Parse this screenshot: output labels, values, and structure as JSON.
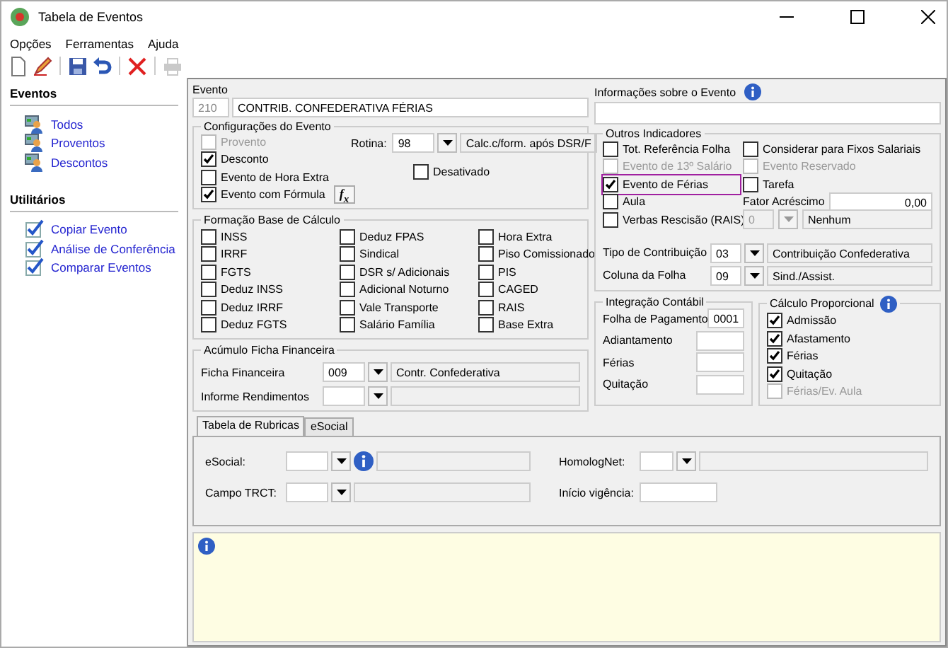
{
  "window": {
    "title": "Tabela de Eventos"
  },
  "menu": [
    {
      "label": "Opções"
    },
    {
      "label": "Ferramentas"
    },
    {
      "label": "Ajuda"
    }
  ],
  "toolbar": [
    {
      "kind": "new",
      "disabled": false
    },
    {
      "kind": "edit",
      "disabled": false
    },
    {
      "kind": "save",
      "disabled": false
    },
    {
      "kind": "undo",
      "disabled": false
    },
    {
      "kind": "delete",
      "disabled": false
    },
    {
      "kind": "print",
      "disabled": true
    }
  ],
  "sidebar": [
    {
      "title": "Eventos",
      "items": [
        {
          "label": "Todos",
          "kind": "group"
        },
        {
          "label": "Proventos",
          "kind": "group"
        },
        {
          "label": "Descontos",
          "kind": "group"
        }
      ]
    },
    {
      "title": "Utilitários",
      "items": [
        {
          "label": "Copiar Evento",
          "kind": "check"
        },
        {
          "label": "Análise de Conferência",
          "kind": "check"
        },
        {
          "label": "Comparar Eventos",
          "kind": "check"
        }
      ]
    }
  ],
  "evento": {
    "label": "Evento",
    "code": "210",
    "name": "CONTRIB. CONFEDERATIVA FÉRIAS"
  },
  "info": {
    "label": "Informações sobre o Evento"
  },
  "config": {
    "title": "Configurações do Evento",
    "checks": [
      {
        "label": "Provento",
        "checked": false,
        "disabled": true
      },
      {
        "label": "Desconto",
        "checked": true,
        "disabled": false
      },
      {
        "label": "Evento de Hora Extra",
        "checked": false,
        "disabled": false
      },
      {
        "label": "Evento com Fórmula",
        "checked": true,
        "disabled": false
      }
    ],
    "formula_button": "f$_{x}$",
    "rotina": {
      "label": "Rotina:",
      "code": "98",
      "desc": "Calc.c/form. após DSR/F"
    },
    "desativado": {
      "label": "Desativado",
      "checked": false
    }
  },
  "base": {
    "title": "Formação Base de Cálculo",
    "columns": [
      [
        {
          "label": "INSS",
          "checked": false
        },
        {
          "label": "IRRF",
          "checked": false
        },
        {
          "label": "FGTS",
          "checked": false
        },
        {
          "label": "Deduz INSS",
          "checked": false
        },
        {
          "label": "Deduz IRRF",
          "checked": false
        },
        {
          "label": "Deduz FGTS",
          "checked": false
        }
      ],
      [
        {
          "label": "Deduz FPAS",
          "checked": false
        },
        {
          "label": "Sindical",
          "checked": false
        },
        {
          "label": "DSR s/ Adicionais",
          "checked": false
        },
        {
          "label": "Adicional Noturno",
          "checked": false
        },
        {
          "label": "Vale Transporte",
          "checked": false
        },
        {
          "label": "Salário Família",
          "checked": false
        }
      ],
      [
        {
          "label": "Hora Extra",
          "checked": false
        },
        {
          "label": "Piso Comissionado",
          "checked": false
        },
        {
          "label": "PIS",
          "checked": false
        },
        {
          "label": "CAGED",
          "checked": false
        },
        {
          "label": "RAIS",
          "checked": false
        },
        {
          "label": "Base Extra",
          "checked": false
        }
      ]
    ]
  },
  "acumulo": {
    "title": "Acúmulo Ficha Financeira",
    "rows": [
      {
        "label": "Ficha Financeira",
        "code": "009",
        "desc": "Contr. Confederativa"
      },
      {
        "label": "Informe Rendimentos"
      }
    ]
  },
  "outros": {
    "title": "Outros Indicadores",
    "left": [
      {
        "label": "Tot. Referência Folha",
        "checked": false,
        "disabled": false,
        "focused": false
      },
      {
        "label": "Evento de 13º Salário",
        "checked": false,
        "disabled": true,
        "focused": false
      },
      {
        "label": "Evento de Férias",
        "checked": true,
        "disabled": false,
        "focused": true
      },
      {
        "label": "Aula",
        "checked": false,
        "disabled": false,
        "focused": false
      },
      {
        "label": "Verbas Rescisão (RAIS)",
        "checked": false,
        "disabled": false,
        "focused": false
      }
    ],
    "right": [
      {
        "label": "Considerar para Fixos Salariais",
        "checked": false,
        "disabled": false,
        "focused": false
      },
      {
        "label": "Evento Reservado",
        "checked": false,
        "disabled": true,
        "focused": false
      },
      {
        "label": "Tarefa",
        "checked": false,
        "disabled": false,
        "focused": false
      }
    ],
    "fator": {
      "label": "Fator Acréscimo",
      "value": "0,00"
    },
    "aula_combo": {
      "code": "0",
      "desc": "Nenhum",
      "disabled": true
    },
    "combos": [
      {
        "label": "Tipo de Contribuição",
        "code": "03",
        "desc": "Contribuição Confederativa"
      },
      {
        "label": "Coluna da Folha",
        "code": "09",
        "desc": "Sind./Assist."
      }
    ]
  },
  "integracao": {
    "title": "Integração Contábil",
    "rows": [
      {
        "label": "Folha de Pagamento",
        "value": "0001"
      },
      {
        "label": "Adiantamento"
      },
      {
        "label": "Férias"
      },
      {
        "label": "Quitação"
      }
    ]
  },
  "calculo": {
    "title": "Cálculo Proporcional",
    "checks": [
      {
        "label": "Admissão",
        "checked": true,
        "disabled": false
      },
      {
        "label": "Afastamento",
        "checked": true,
        "disabled": false
      },
      {
        "label": "Férias",
        "checked": true,
        "disabled": false
      },
      {
        "label": "Quitação",
        "checked": true,
        "disabled": false
      },
      {
        "label": "Férias/Ev. Aula",
        "checked": false,
        "disabled": true
      }
    ]
  },
  "tabs": [
    {
      "label": "Tabela de Rubricas",
      "selected": true
    },
    {
      "label": "eSocial",
      "selected": false
    }
  ],
  "rubricas": {
    "esocial": {
      "label": "eSocial:"
    },
    "trct": {
      "label": "Campo TRCT:"
    },
    "homolog": {
      "label": "HomologNet:"
    },
    "vigencia": {
      "label": "Início vigência:"
    }
  }
}
